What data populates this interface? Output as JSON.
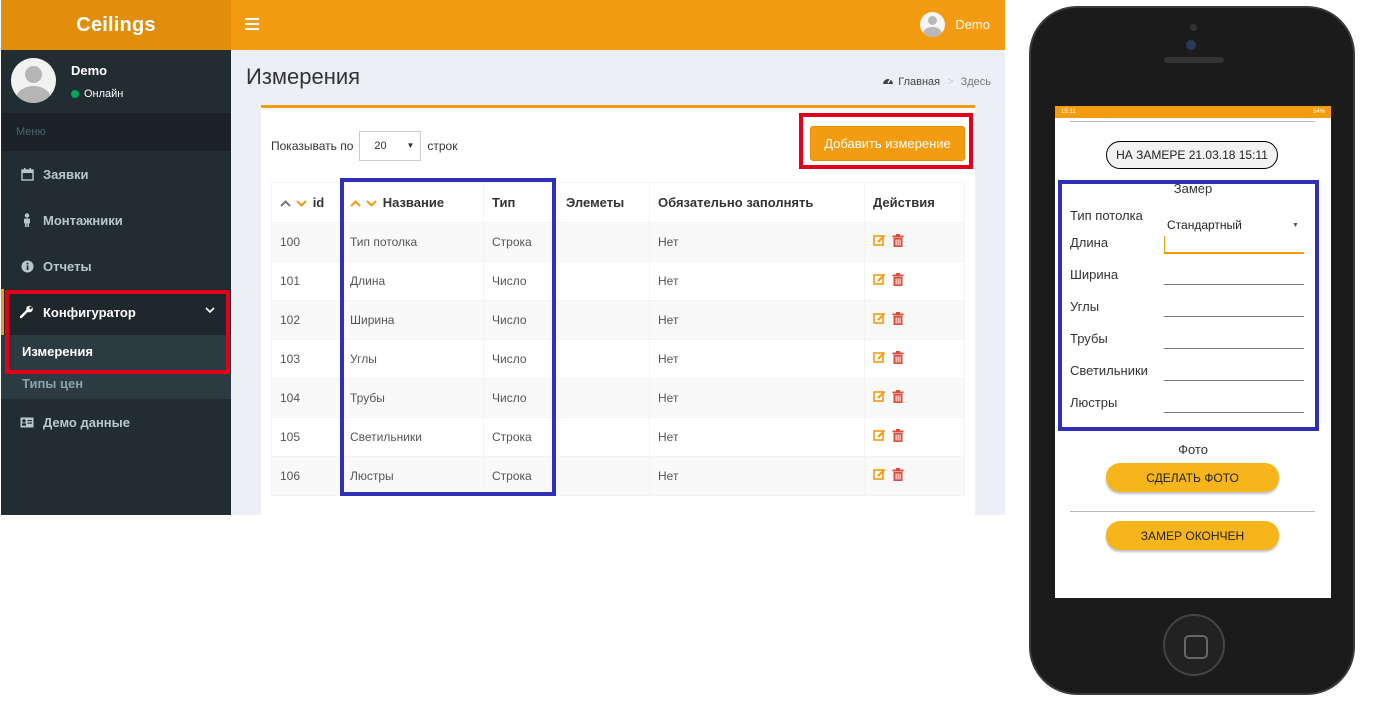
{
  "app": {
    "logo": "Ceilings",
    "top_user": "Demo"
  },
  "sidebar": {
    "user_name": "Demo",
    "user_status": "Онлайн",
    "menu_header": "Меню",
    "items": [
      {
        "label": "Заявки",
        "icon": "calendar-icon"
      },
      {
        "label": "Монтажники",
        "icon": "person-icon"
      },
      {
        "label": "Отчеты",
        "icon": "info-icon"
      },
      {
        "label": "Конфигуратор",
        "icon": "wrench-icon"
      },
      {
        "label": "Демо данные",
        "icon": "id-card-icon"
      }
    ],
    "submenu": [
      "Измерения",
      "Типы цен"
    ]
  },
  "content": {
    "title": "Измерения",
    "breadcrumb": [
      "Главная",
      "Здесь"
    ],
    "show_prefix": "Показывать по",
    "show_value": "20",
    "show_suffix": "строк",
    "add_button": "Добавить измерение"
  },
  "table": {
    "headers": [
      "id",
      "Название",
      "Тип",
      "Элеметы",
      "Обязательно заполнять",
      "Действия"
    ],
    "rows": [
      {
        "id": "100",
        "name": "Тип потолка",
        "type": "Строка",
        "elements": "",
        "required": "Нет"
      },
      {
        "id": "101",
        "name": "Длина",
        "type": "Число",
        "elements": "",
        "required": "Нет"
      },
      {
        "id": "102",
        "name": "Ширина",
        "type": "Число",
        "elements": "",
        "required": "Нет"
      },
      {
        "id": "103",
        "name": "Углы",
        "type": "Число",
        "elements": "",
        "required": "Нет"
      },
      {
        "id": "104",
        "name": "Трубы",
        "type": "Число",
        "elements": "",
        "required": "Нет"
      },
      {
        "id": "105",
        "name": "Светильники",
        "type": "Строка",
        "elements": "",
        "required": "Нет"
      },
      {
        "id": "106",
        "name": "Люстры",
        "type": "Строка",
        "elements": "",
        "required": "Нет"
      }
    ]
  },
  "phone": {
    "status_time": "15:11",
    "status_battery": "54%",
    "header_pill": "НА ЗАМЕРЕ 21.03.18 15:11",
    "section_title": "Замер",
    "ceiling_type_label": "Тип потолка",
    "ceiling_type_value": "Стандартный",
    "fields": [
      "Длина",
      "Ширина",
      "Углы",
      "Трубы",
      "Светильники",
      "Люстры"
    ],
    "photo_title": "Фото",
    "photo_button": "СДЕЛАТЬ ФОТО",
    "finish_button": "ЗАМЕР ОКОНЧЕН"
  },
  "colors": {
    "accent": "#f39c12",
    "sidebar": "#222d32",
    "highlight_red": "#e3001b",
    "highlight_blue": "#2f2fb8"
  }
}
